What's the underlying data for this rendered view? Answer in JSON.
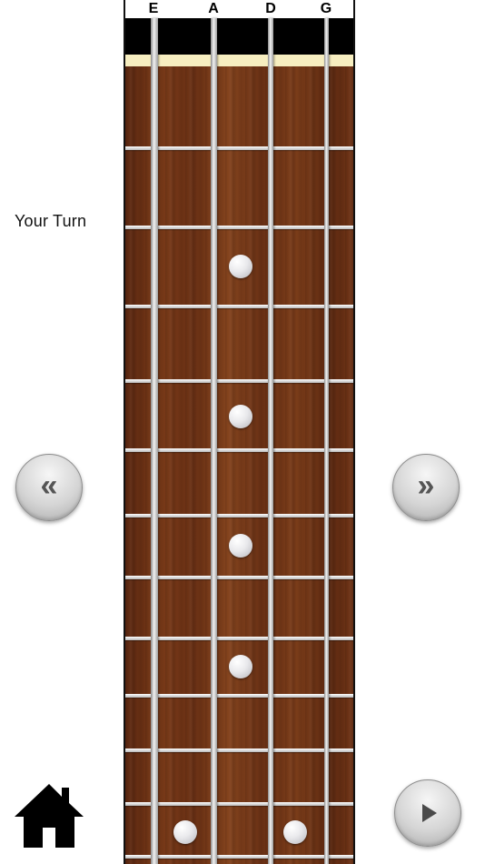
{
  "status_text": "Your Turn",
  "strings": [
    "E",
    "A",
    "D",
    "G"
  ],
  "controls": {
    "prev_icon": "double-chevron-left-icon",
    "next_icon": "double-chevron-right-icon",
    "play_icon": "play-icon",
    "home_icon": "home-icon"
  },
  "colors": {
    "fretboard_wood": "#6e3316",
    "nut": "#f7eec0",
    "headstock": "#000000",
    "inlay": "#e9e9ec"
  }
}
